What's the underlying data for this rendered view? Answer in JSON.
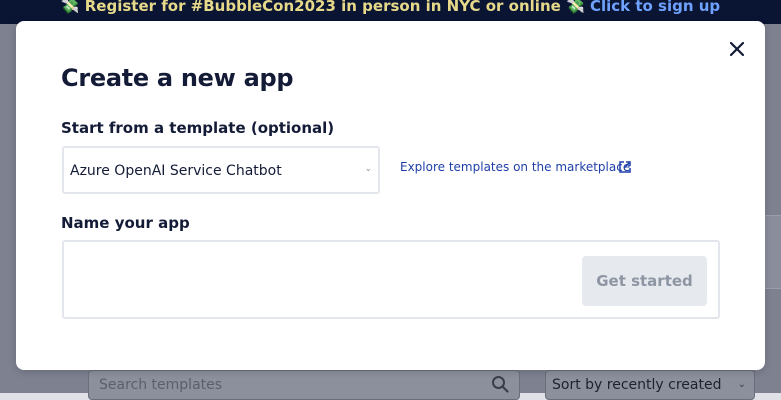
{
  "banner": {
    "emoji_left": "💸",
    "text": " Register for #BubbleCon2023 in person in NYC or online ",
    "emoji_right": "💸",
    "link": "Click to sign up"
  },
  "background": {
    "search_placeholder": "Search templates",
    "search_icon": "search-icon",
    "sort_value": "Sort by recently created"
  },
  "modal": {
    "title": "Create a new app",
    "close_icon": "close-icon",
    "template_label": "Start from a template (optional)",
    "template_value": "Azure OpenAI Service Chatbot",
    "explore_link": "Explore templates on the marketplace",
    "external_link_icon": "external-link-icon",
    "name_label": "Name your app",
    "name_value": "",
    "get_started_label": "Get started"
  },
  "colors": {
    "banner_bg": "#0a1433",
    "title_text": "#131b37",
    "link": "#1f3fa8",
    "button_disabled_bg": "#e6e9ee",
    "button_disabled_text": "#8e95a3"
  }
}
